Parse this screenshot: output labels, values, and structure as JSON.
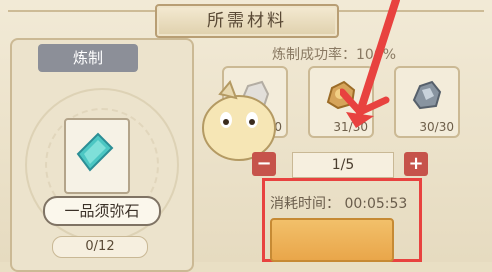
{
  "title": "所需材料",
  "left_panel": {
    "tag": "炼制",
    "item_name": "一品须弥石",
    "count": "0/12"
  },
  "rate": {
    "label": "炼制成功率：",
    "value": "100%"
  },
  "materials": [
    {
      "count": "30/30",
      "color": "#e2dfda"
    },
    {
      "count": "31/30",
      "color": "#d6a45a"
    },
    {
      "count": "30/30",
      "color": "#8894a0"
    }
  ],
  "quantity": "1/5",
  "consume_time": {
    "label": "消耗时间：",
    "value": "00:05:53"
  },
  "colors": {
    "highlight": "#e8423f",
    "button": "#c6534b"
  }
}
